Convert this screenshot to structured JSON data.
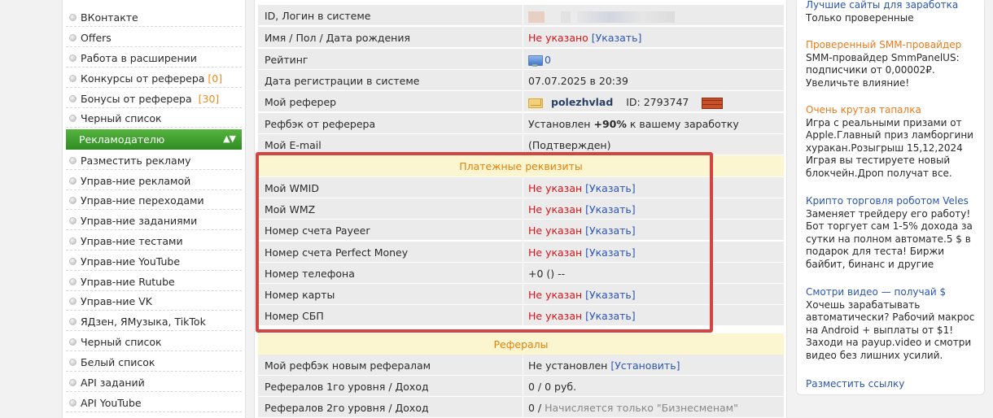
{
  "sidebar": {
    "items_top": [
      {
        "label": "ВКонтакте",
        "count": ""
      },
      {
        "label": "Offers",
        "count": ""
      },
      {
        "label": "Работа в расширении",
        "count": ""
      },
      {
        "label": "Конкурсы от реферера",
        "count": "[0]"
      },
      {
        "label": "Бонусы от реферера",
        "count": "[30]"
      },
      {
        "label": "Черный список",
        "count": ""
      }
    ],
    "section": {
      "label": "Рекламодателю",
      "arrows": "▲▼"
    },
    "items_bottom": [
      {
        "label": "Разместить рекламу"
      },
      {
        "label": "Управ-ние рекламой"
      },
      {
        "label": "Управ-ние переходами"
      },
      {
        "label": "Управ-ние заданиями"
      },
      {
        "label": "Управ-ние тестами"
      },
      {
        "label": "Управ-ние YouTube"
      },
      {
        "label": "Управ-ние Rutube"
      },
      {
        "label": "Управ-ние VK"
      },
      {
        "label": "ЯДзен, ЯМузыка, TikTok"
      },
      {
        "label": "Черный список"
      },
      {
        "label": "Белый список"
      },
      {
        "label": "API заданий"
      },
      {
        "label": "API YouTube"
      }
    ]
  },
  "profile": {
    "id_label": "ID, Логин в системе",
    "name_label": "Имя / Пол / Дата рождения",
    "name_value": "Не указано",
    "name_link": "[Указать]",
    "rating_label": "Рейтинг",
    "rating_value": "0",
    "regdate_label": "Дата регистрации в системе",
    "regdate_value": "07.07.2025 в 20:39",
    "referer_label": "Мой реферер",
    "referer_name": "polezhvlad",
    "referer_id": "ID: 2793747",
    "refback_label": "Рефбэк от реферера",
    "refback_prefix": "Установлен",
    "refback_percent": "+90%",
    "refback_suffix": "к вашему заработку",
    "email_label": "Мой E-mail",
    "email_value": "(Подтвержден)"
  },
  "payment": {
    "title": "Платежные реквизиты",
    "rows": [
      {
        "label": "Мой WMID",
        "value": "Не указан",
        "link": "[Указать]"
      },
      {
        "label": "Мой WMZ",
        "value": "Не указан",
        "link": "[Указать]"
      },
      {
        "label": "Номер счета Payeer",
        "value": "Не указан",
        "link": "[Указать]"
      },
      {
        "label": "Номер счета Perfect Money",
        "value": "Не указан",
        "link": "[Указать]"
      },
      {
        "label": "Номер телефона",
        "value": "+0 () --",
        "link": ""
      },
      {
        "label": "Номер карты",
        "value": "Не указан",
        "link": "[Указать]"
      },
      {
        "label": "Номер СБП",
        "value": "Не указан",
        "link": "[Указать]"
      }
    ]
  },
  "referrals": {
    "title": "Рефералы",
    "refback_new_label": "Мой рефбэк новым рефералам",
    "refback_new_value": "Не установлен",
    "refback_new_link": "[Установить]",
    "lvl1_label": "Рефералов 1го уровня / Доход",
    "lvl1_value": "0 / 0 руб.",
    "lvl2_label": "Рефералов 2го уровня / Доход",
    "lvl2_value": "0 /",
    "lvl2_note": "Начисляется только \"Бизнесменам\""
  },
  "ads": [
    {
      "title": "Лучшие сайты для заработка",
      "text": "Только проверенные",
      "color": "#2c56b0"
    },
    {
      "title": "Проверенный SMM-провайдер",
      "text": "SMM-провайдер SmmPanelUS: подписчики от 0,00002₽. Увеличьте влияние!",
      "color": "#ee7a1c"
    },
    {
      "title": "Очень крутая тапалка",
      "text": "Игра с реальными призами от Apple.Главный приз ламборгини хуракан.Розыгрыш 15,12,2024 Играя вы тестируете новый блокчейн.Дроп получат все.",
      "color": "#ee7a1c"
    },
    {
      "title": "Крипто торговля роботом Veles",
      "text": "Заменяет трейдеру его работу! Бот торгует сам 1-5% дохода за сутки на полном автомате.5 $ в подарок для теста! Биржи байбит, бинанс и другие",
      "color": "#2c56b0"
    },
    {
      "title": "Смотри видео — получай $",
      "text": "Хочешь зарабатывать автоматически? Рабочий макрос на Android + выплаты от $1! Заходи на payup.video и смотри видео без лишних усилий.",
      "color": "#2c56b0"
    }
  ],
  "ad_link": "Разместить ссылку"
}
